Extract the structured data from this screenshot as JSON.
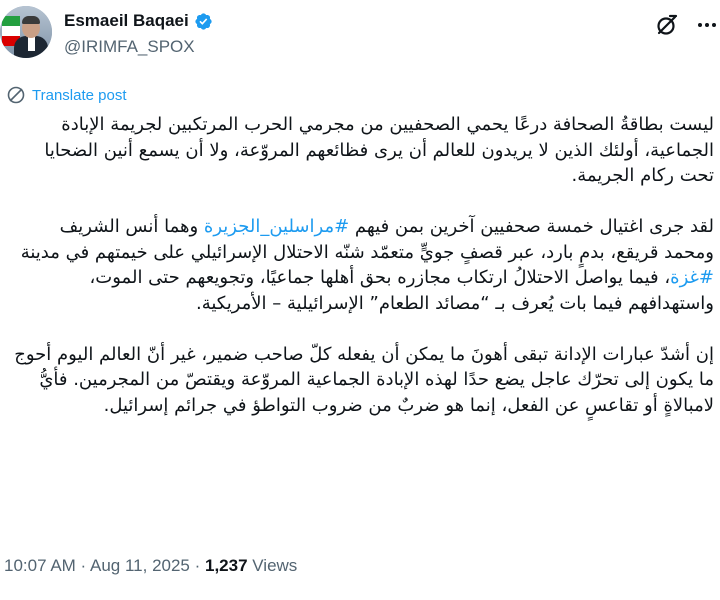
{
  "author": {
    "name": "Esmaeil Baqaei",
    "handle": "@IRIMFA_SPOX",
    "verified_badge": "verified-check-icon",
    "badge_color": "#1d9bf0"
  },
  "actions": {
    "translate_label": "Translate post"
  },
  "post": {
    "p1": "ليست بطاقةُ الصحافة درعًا يحمي الصحفيين من مجرمي الحرب المرتكبين لجريمة الإبادة الجماعية، أولئك الذين لا يريدون للعالم أن يرى فظائعهم المروّعة، ولا أن يسمع أنين الضحايا تحت ركام الجريمة.",
    "p2_before": "لقد جرى اغتيال خمسة صحفيين آخرين بمن فيهم ",
    "p2_hashtag1": "#مراسلين_الجزيرة",
    "p2_middle": " وهما أنس الشريف ومحمد قريقع، بدمٍ بارد، عبر قصفٍ جويٍّ متعمّد شنّه الاحتلال الإسرائيلي على خيمتهم في مدينة ",
    "p2_hashtag2": "#غزة",
    "p2_after": "، فيما يواصل الاحتلالُ ارتكاب مجازره بحق أهلها جماعيًا، وتجويعهم حتى الموت، واستهدافهم فيما بات يُعرف بـ “مصائد الطعام” الإسرائيلية – الأمريكية.",
    "p3": "إن أشدّ عبارات الإدانة تبقى أهونَ ما يمكن أن يفعله كلّ صاحب ضمير، غير أنّ العالم اليوم أحوج ما يكون إلى تحرّك عاجل يضع حدًا لهذه الإبادة الجماعية المروّعة ويقتصّ من المجرمين. فأيُّ لامبالاةٍ أو تقاعسٍ عن الفعل، إنما هو ضربٌ من ضروب التواطؤ في جرائم إسرائيل."
  },
  "meta": {
    "time": "10:07 AM",
    "separator1": " · ",
    "date": "Aug 11, 2025",
    "separator2": " · ",
    "views_count": "1,237",
    "views_label": " Views"
  },
  "colors": {
    "link": "#1d9bf0",
    "secondary_text": "#536471",
    "primary_text": "#0f1419"
  }
}
